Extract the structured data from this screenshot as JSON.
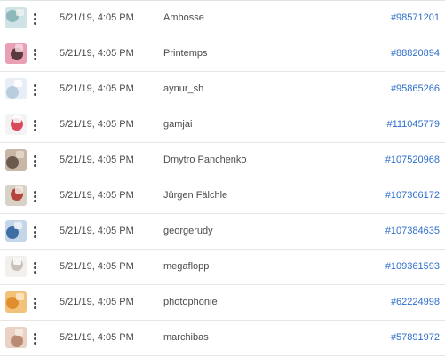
{
  "rows": [
    {
      "date": "5/21/19, 4:05 PM",
      "contributor": "Ambosse",
      "id": "#98571201",
      "thumb_icon": "bathroom-photo-thumbnail",
      "thumb_colors": [
        "#cfe3e6",
        "#8fb8bd",
        "#f0f0f0"
      ]
    },
    {
      "date": "5/21/19, 4:05 PM",
      "contributor": "Printemps",
      "id": "#88820894",
      "thumb_icon": "flower-photo-thumbnail",
      "thumb_colors": [
        "#e9a0b4",
        "#5a3a3f",
        "#f4d7df"
      ]
    },
    {
      "date": "5/21/19, 4:05 PM",
      "contributor": "aynur_sh",
      "id": "#95865266",
      "thumb_icon": "medicine-photo-thumbnail",
      "thumb_colors": [
        "#e8eef5",
        "#b9cde0",
        "#ffffff"
      ]
    },
    {
      "date": "5/21/19, 4:05 PM",
      "contributor": "gamjai",
      "id": "#111045779",
      "thumb_icon": "sign-photo-thumbnail",
      "thumb_colors": [
        "#f3f3f3",
        "#d84b5c",
        "#ffffff"
      ]
    },
    {
      "date": "5/21/19, 4:05 PM",
      "contributor": "Dmytro Panchenko",
      "id": "#107520968",
      "thumb_icon": "portrait-photo-thumbnail",
      "thumb_colors": [
        "#c9b6a4",
        "#6a5a4e",
        "#e7dacd"
      ]
    },
    {
      "date": "5/21/19, 4:05 PM",
      "contributor": "Jürgen Fälchle",
      "id": "#107366172",
      "thumb_icon": "tools-photo-thumbnail",
      "thumb_colors": [
        "#d8d2c6",
        "#b5453a",
        "#f1ede6"
      ]
    },
    {
      "date": "5/21/19, 4:05 PM",
      "contributor": "georgerudy",
      "id": "#107384635",
      "thumb_icon": "office-photo-thumbnail",
      "thumb_colors": [
        "#c4d6e8",
        "#3d6ea3",
        "#eef3f8"
      ]
    },
    {
      "date": "5/21/19, 4:05 PM",
      "contributor": "megaflopp",
      "id": "#109361593",
      "thumb_icon": "hand-photo-thumbnail",
      "thumb_colors": [
        "#f2efec",
        "#c8c1ba",
        "#ffffff"
      ]
    },
    {
      "date": "5/21/19, 4:05 PM",
      "contributor": "photophonie",
      "id": "#62224998",
      "thumb_icon": "food-photo-thumbnail",
      "thumb_colors": [
        "#f3c27a",
        "#e08d2f",
        "#fbe9cf"
      ]
    },
    {
      "date": "5/21/19, 4:05 PM",
      "contributor": "marchibas",
      "id": "#57891972",
      "thumb_icon": "baby-photo-thumbnail",
      "thumb_colors": [
        "#e9d2c3",
        "#b88b74",
        "#f6ebe3"
      ]
    }
  ]
}
